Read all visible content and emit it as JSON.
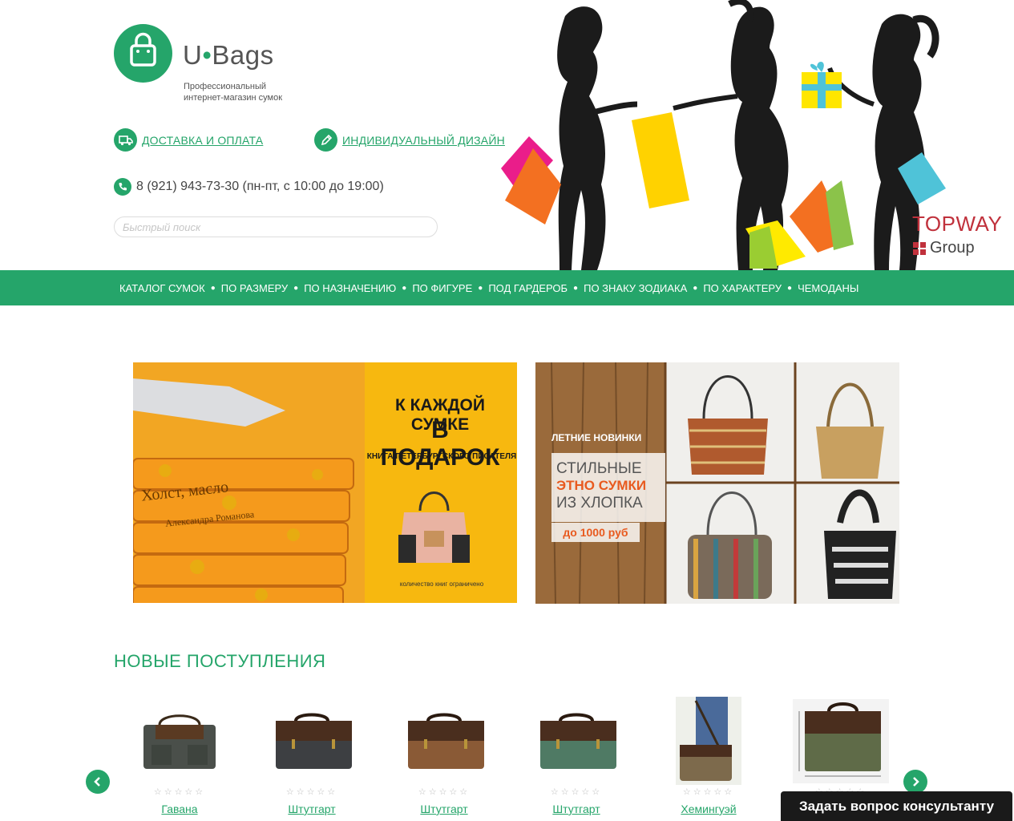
{
  "header": {
    "logo_name_left": "U",
    "logo_name_right": "Bags",
    "tagline_line1": "Профессиональный",
    "tagline_line2": "интернет-магазин сумок",
    "link_delivery": "ДОСТАВКА И ОПЛАТА",
    "link_design": "ИНДИВИДУАЛЬНЫЙ ДИЗАЙН",
    "phone": "8 (921) 943-73-30 (пн-пт, с 10:00 до 19:00)",
    "search_placeholder": "Быстрый поиск",
    "partner_name": "TOPWAY",
    "partner_group": "Group"
  },
  "nav": {
    "items": [
      "КАТАЛОГ СУМОК",
      "ПО РАЗМЕРУ",
      "ПО НАЗНАЧЕНИЮ",
      "ПО ФИГУРЕ",
      "ПОД ГАРДЕРОБ",
      "ПО ЗНАКУ ЗОДИАКА",
      "ПО ХАРАКТЕРУ",
      "ЧЕМОДАНЫ"
    ]
  },
  "banner_left": {
    "title_line1": "К КАЖДОЙ СУМКЕ",
    "title_line2": "В ПОДАРОК",
    "subtitle": "КНИГА ПЕТЕРБУРГСКОГО ПИСАТЕЛЯ",
    "note": "количество книг ограничено",
    "book_title": "Холст, масло",
    "book_author": "Александра Романова"
  },
  "banner_right": {
    "label": "ЛЕТНИЕ НОВИНКИ",
    "line1": "СТИЛЬНЫЕ",
    "line2": "ЭТНО СУМКИ",
    "line3": "ИЗ ХЛОПКА",
    "price": "до 1000 руб"
  },
  "section": {
    "title": "НОВЫЕ ПОСТУПЛЕНИЯ"
  },
  "products": [
    {
      "name": "Гавана",
      "color": "#4a4f4a"
    },
    {
      "name": "Штутгарт",
      "color": "#3d3f42"
    },
    {
      "name": "Штутгарт",
      "color": "#8a5a36"
    },
    {
      "name": "Штутгарт",
      "color": "#4f7a64"
    },
    {
      "name": "Хемингуэй",
      "color": "#7d6a4c"
    },
    {
      "name": "",
      "color": "#5f6b48"
    }
  ],
  "stars_text": "☆☆☆☆☆",
  "consult_button": "Задать вопрос консультанту",
  "colors": {
    "accent": "#25a56a",
    "banner_yellow": "#f7b80f",
    "partner_red": "#c0313c"
  }
}
